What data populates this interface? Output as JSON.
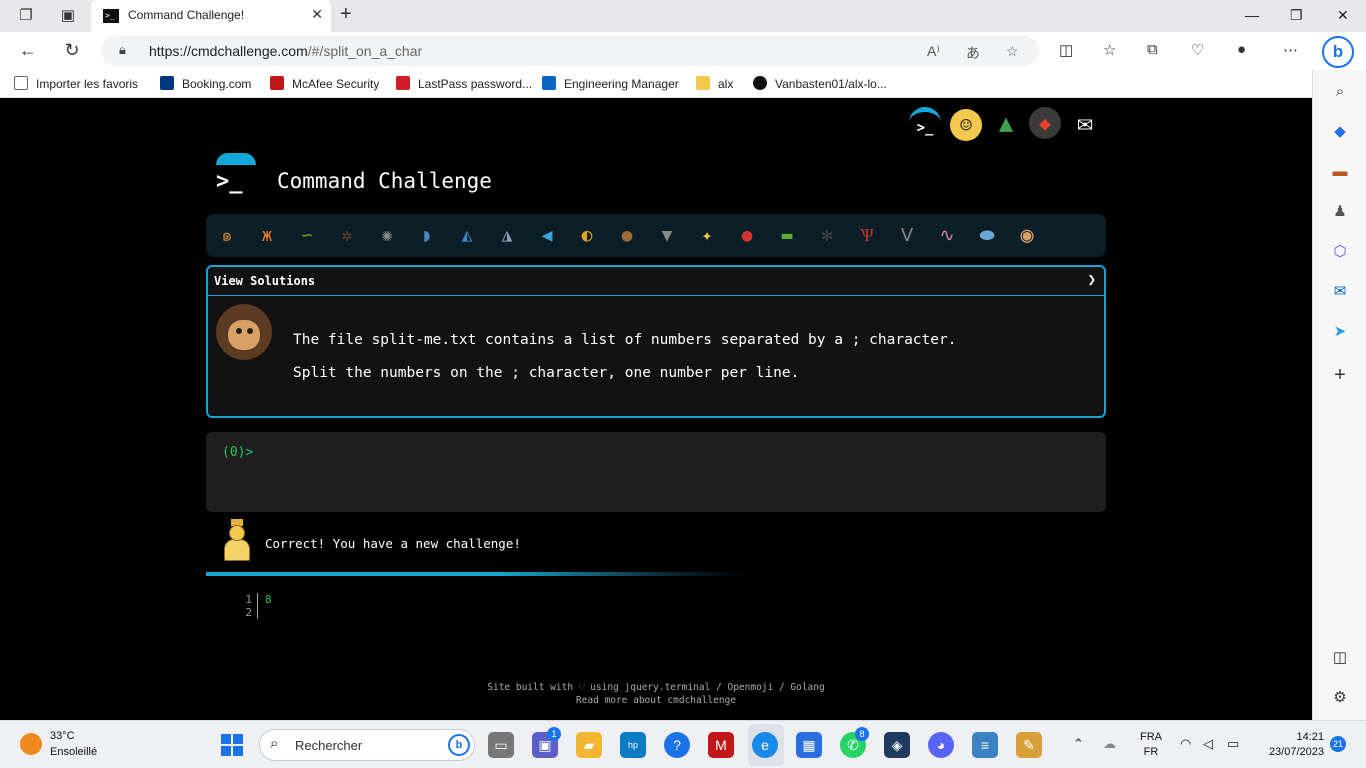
{
  "browser": {
    "tab_title": "Command Challenge!",
    "url_host": "https://cmdchallenge.com",
    "url_path": "/#/split_on_a_char",
    "favorites": [
      {
        "label": "Importer les favoris",
        "color": "#666666"
      },
      {
        "label": "Booking.com",
        "color": "#003580"
      },
      {
        "label": "McAfee Security",
        "color": "#c01818"
      },
      {
        "label": "LastPass password...",
        "color": "#cc2029"
      },
      {
        "label": "Engineering Manager",
        "color": "#0a66c2"
      },
      {
        "label": "alx",
        "color": "#f2c94c"
      },
      {
        "label": "Vanbasten01/alx-lo...",
        "color": "#111111"
      }
    ]
  },
  "page": {
    "app_title": "Command Challenge",
    "view_solutions": "View Solutions",
    "challenge_line1": "The file split-me.txt contains a list of numbers separated by a ; character.",
    "challenge_line2": "Split the numbers on the ; character, one number per line.",
    "prompt": "(0)>",
    "success_message": "Correct! You have a new challenge!",
    "output_lines": [
      {
        "num": "1",
        "text": "8"
      },
      {
        "num": "2",
        "text": ""
      }
    ],
    "footer_line1": "Site built with ♡ using jquery.terminal / Openmoji / Golang",
    "footer_line2": "Read more about cmdchallenge",
    "animals": [
      "snail-icon",
      "butterfly-icon",
      "caterpillar-icon",
      "ant-icon",
      "spider-web-icon",
      "whale-icon",
      "shark-icon",
      "dolphin-icon",
      "fish-icon",
      "tropical-fish-icon",
      "blowfish-icon",
      "wolf-icon",
      "bee-icon",
      "ladybug-icon",
      "cricket-icon",
      "spider-icon",
      "lobster-icon",
      "fly-icon",
      "worm-icon",
      "microbe-icon",
      "monkey-icon"
    ]
  },
  "taskbar": {
    "temperature": "33°C",
    "weather_desc": "Ensoleillé",
    "search_placeholder": "Rechercher",
    "lang_line1": "FRA",
    "lang_line2": "FR",
    "time": "14:21",
    "date": "23/07/2023",
    "notifications": "21",
    "teams_badge": "1",
    "whatsapp_badge": "8"
  },
  "colors": {
    "accent": "#16a3cc",
    "prompt_green": "#22c55e"
  }
}
